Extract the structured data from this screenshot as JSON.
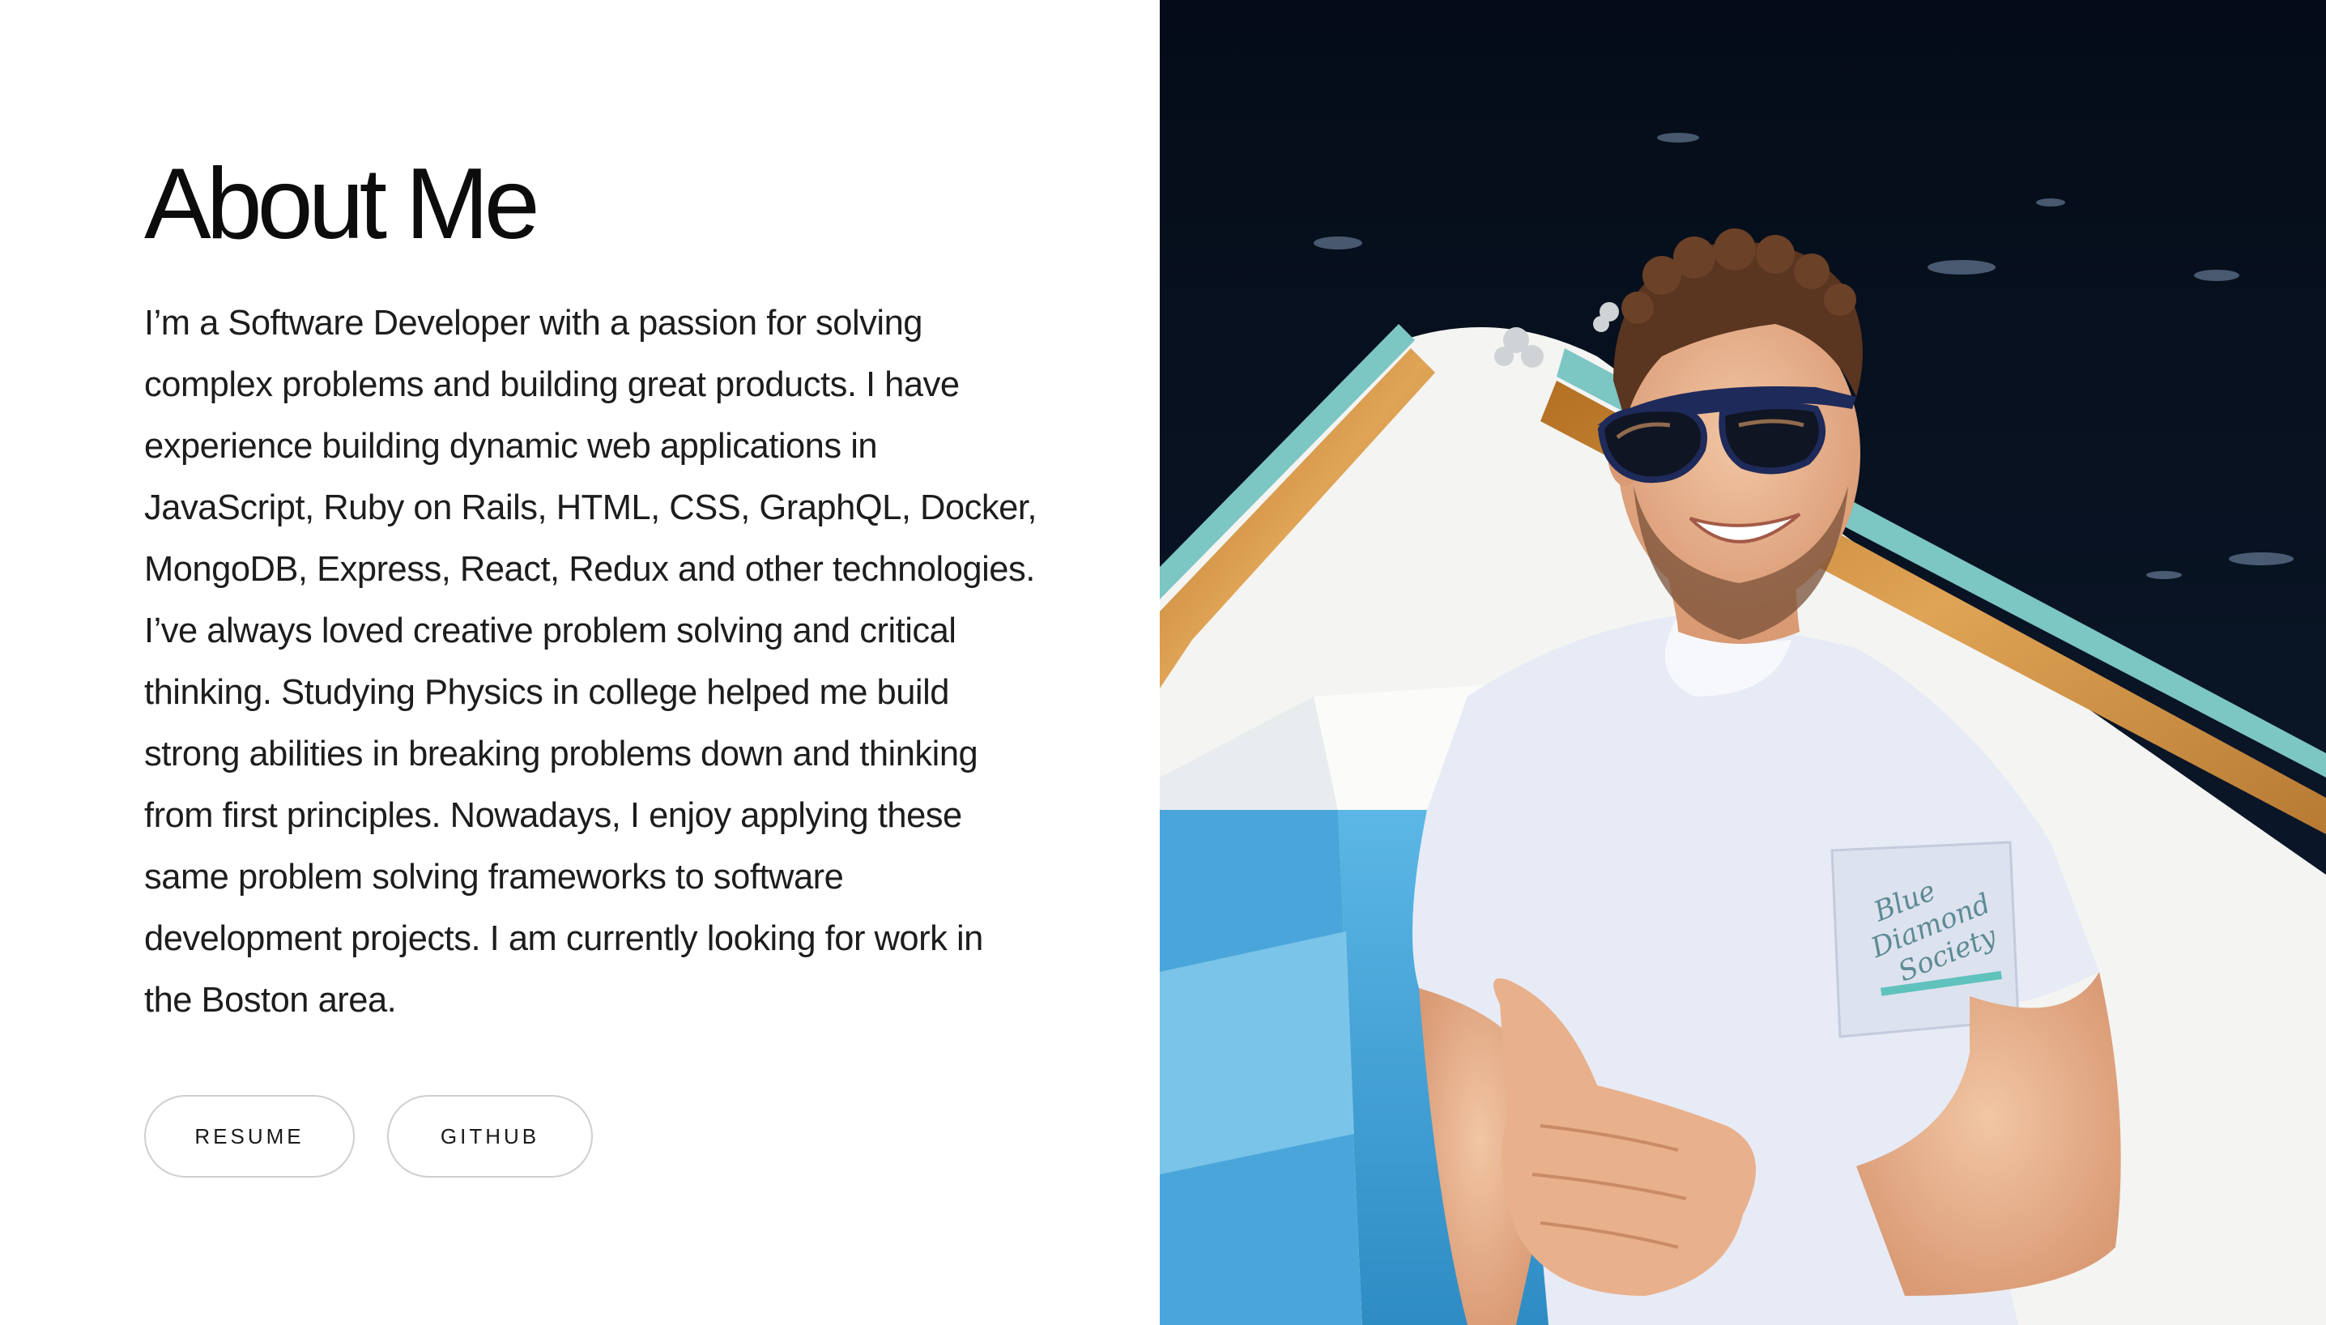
{
  "about": {
    "title": "About Me",
    "bio_lines": [
      "I’m a Software Developer with a passion for solving",
      "complex problems and building great products. I have",
      "experience building dynamic web applications in",
      "JavaScript, Ruby on Rails, HTML, CSS, GraphQL, Docker,",
      "MongoDB, Express, React, Redux and other technologies.",
      "I’ve always loved creative problem solving and critical",
      "thinking. Studying Physics in college helped me build",
      "strong abilities in breaking problems down and thinking",
      "from first principles. Nowadays, I enjoy applying these",
      "same problem solving frameworks to software",
      "development projects. I am currently looking for work in",
      "the Boston area."
    ]
  },
  "buttons": {
    "resume_label": "RESUME",
    "github_label": "GITHUB"
  },
  "photo": {
    "shirt_print": [
      "Blue",
      "Diamond",
      "Society"
    ]
  },
  "colors": {
    "water": "#0a1524",
    "boat_wood": "#c98a3a",
    "boat_interior": "#3d9fd4",
    "shirt": "#e8ebf5"
  }
}
